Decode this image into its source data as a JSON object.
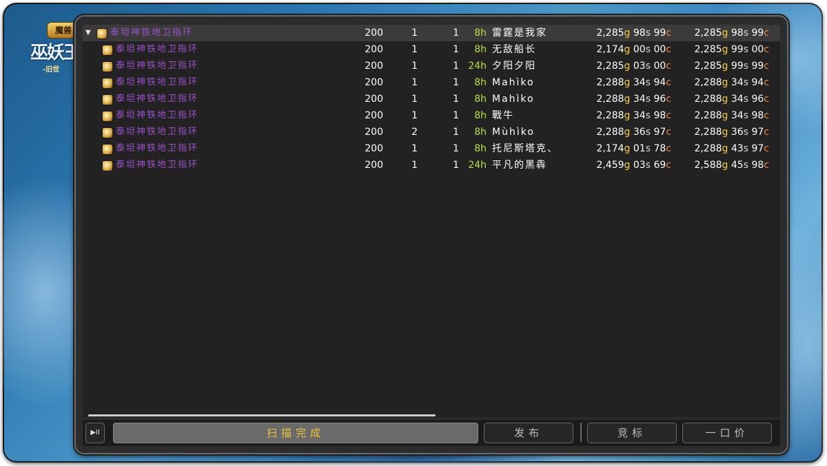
{
  "logo": {
    "badge": "魔兽",
    "title": "巫妖王",
    "subtitle": "-旧世"
  },
  "rows": [
    {
      "name": "泰坦神铁地卫指环",
      "level": "200",
      "stack": "1",
      "count": "1",
      "time": "8h",
      "seller": "雷霆是我家",
      "bid": {
        "g": "2,285",
        "s": "98",
        "c": "99"
      },
      "buyout": {
        "g": "2,285",
        "s": "98",
        "c": "99"
      }
    },
    {
      "name": "泰坦神铁地卫指环",
      "level": "200",
      "stack": "1",
      "count": "1",
      "time": "8h",
      "seller": "无敌船长",
      "bid": {
        "g": "2,174",
        "s": "00",
        "c": "00"
      },
      "buyout": {
        "g": "2,285",
        "s": "99",
        "c": "00"
      }
    },
    {
      "name": "泰坦神铁地卫指环",
      "level": "200",
      "stack": "1",
      "count": "1",
      "time": "24h",
      "seller": "夕阳夕阳",
      "bid": {
        "g": "2,285",
        "s": "03",
        "c": "00"
      },
      "buyout": {
        "g": "2,285",
        "s": "99",
        "c": "99"
      }
    },
    {
      "name": "泰坦神铁地卫指环",
      "level": "200",
      "stack": "1",
      "count": "1",
      "time": "8h",
      "seller": "Mahìko",
      "bid": {
        "g": "2,288",
        "s": "34",
        "c": "94"
      },
      "buyout": {
        "g": "2,288",
        "s": "34",
        "c": "94"
      }
    },
    {
      "name": "泰坦神铁地卫指环",
      "level": "200",
      "stack": "1",
      "count": "1",
      "time": "8h",
      "seller": "Mahìko",
      "bid": {
        "g": "2,288",
        "s": "34",
        "c": "96"
      },
      "buyout": {
        "g": "2,288",
        "s": "34",
        "c": "96"
      }
    },
    {
      "name": "泰坦神铁地卫指环",
      "level": "200",
      "stack": "1",
      "count": "1",
      "time": "8h",
      "seller": "戰牛",
      "bid": {
        "g": "2,288",
        "s": "34",
        "c": "98"
      },
      "buyout": {
        "g": "2,288",
        "s": "34",
        "c": "98"
      }
    },
    {
      "name": "泰坦神铁地卫指环",
      "level": "200",
      "stack": "2",
      "count": "1",
      "time": "8h",
      "seller": "Mùhìko",
      "bid": {
        "g": "2,288",
        "s": "36",
        "c": "97"
      },
      "buyout": {
        "g": "2,288",
        "s": "36",
        "c": "97"
      }
    },
    {
      "name": "泰坦神铁地卫指环",
      "level": "200",
      "stack": "1",
      "count": "1",
      "time": "8h",
      "seller": "托尼斯塔克、",
      "bid": {
        "g": "2,174",
        "s": "01",
        "c": "78"
      },
      "buyout": {
        "g": "2,288",
        "s": "43",
        "c": "97"
      }
    },
    {
      "name": "泰坦神铁地卫指环",
      "level": "200",
      "stack": "1",
      "count": "1",
      "time": "24h",
      "seller": "平凡的黑犇",
      "bid": {
        "g": "2,459",
        "s": "03",
        "c": "69"
      },
      "buyout": {
        "g": "2,588",
        "s": "45",
        "c": "98"
      }
    }
  ],
  "currency": {
    "gold": "g",
    "silver": "s",
    "copper": "c"
  },
  "bottom": {
    "play_icon": "▶II",
    "status": "扫描完成",
    "post_label": "发布",
    "bid_label": "竞标",
    "buyout_label": "一口价"
  },
  "colors": {
    "item_name": "#9b52c9",
    "time": "#b7e43a",
    "gold": "#f3cf3a",
    "copper": "#e38a3a",
    "status_text": "#f0c43a"
  },
  "icons": {
    "row_item": "ring-icon",
    "expand": "triangle-down-icon"
  }
}
